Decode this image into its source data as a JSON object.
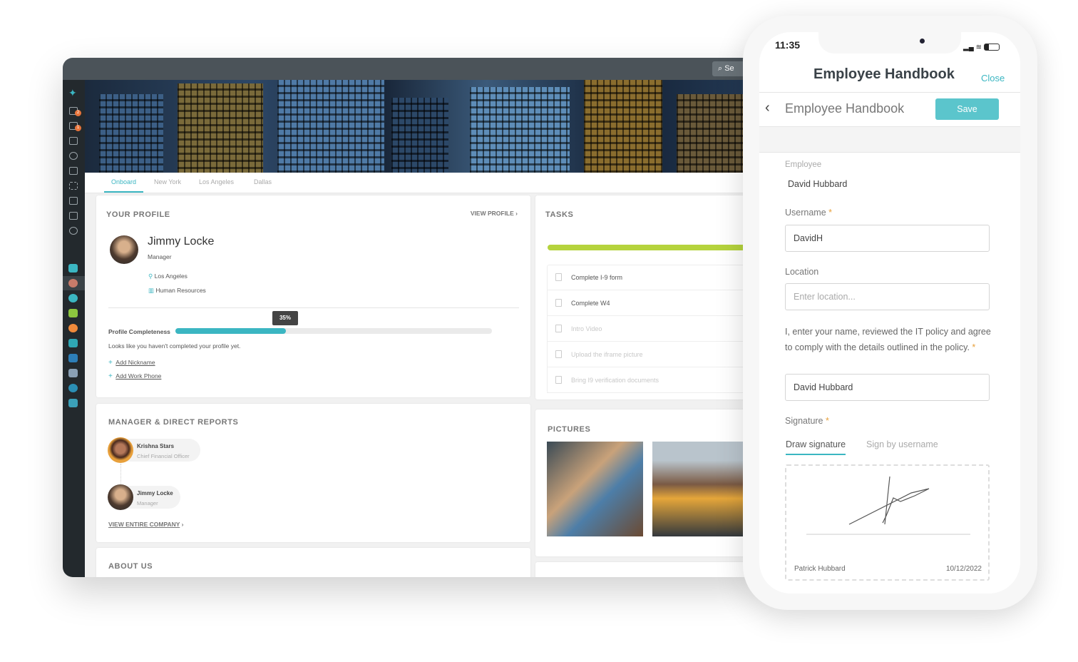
{
  "desktop": {
    "search_label": "Se",
    "sidebar_badges": [
      "2",
      "1"
    ],
    "tabs": [
      {
        "label": "Onboard",
        "active": true
      },
      {
        "label": "New York"
      },
      {
        "label": "Los Angeles"
      },
      {
        "label": "Dallas"
      }
    ],
    "profile": {
      "title": "YOUR PROFILE",
      "view_link": "VIEW PROFILE",
      "name": "Jimmy Locke",
      "role": "Manager",
      "location": "Los Angeles",
      "department": "Human Resources",
      "completeness_label": "Profile Completeness",
      "completeness_percent": 35,
      "completeness_text": "35%",
      "hint": "Looks like you haven't completed your profile yet.",
      "add_nickname": "Add Nickname",
      "add_work_phone": "Add Work Phone"
    },
    "tasks": {
      "title": "TASKS",
      "progress_percent": 100,
      "progress_color": "#b5d33d",
      "items": [
        {
          "label": "Complete I-9 form",
          "icon": "document-icon",
          "done": false
        },
        {
          "label": "Complete W4",
          "icon": "document-icon",
          "done": false
        },
        {
          "label": "Intro Video",
          "icon": "video-icon",
          "done": true
        },
        {
          "label": "Upload the iframe picture",
          "icon": "paperclip-icon",
          "done": true
        },
        {
          "label": "Bring I9 verification documents",
          "icon": "checkbox-icon",
          "done": true
        }
      ]
    },
    "manager": {
      "title": "MANAGER & DIRECT REPORTS",
      "people": [
        {
          "name": "Krishna Stars",
          "role": "Chief Financial Officer"
        },
        {
          "name": "Jimmy Locke",
          "role": "Manager"
        }
      ],
      "view_company": "VIEW ENTIRE COMPANY"
    },
    "pictures": {
      "title": "PICTURES"
    },
    "about": {
      "title": "ABOUT US"
    },
    "accent": "#3bb6c2"
  },
  "phone": {
    "time": "11:35",
    "title": "Employee Handbook",
    "close": "Close",
    "subtitle": "Employee Handbook",
    "save": "Save",
    "employee_label": "Employee",
    "employee_value": "David Hubbard",
    "username_label": "Username",
    "username_value": "DavidH",
    "location_label": "Location",
    "location_placeholder": "Enter location...",
    "policy_label": "I, enter your name, reviewed the IT policy and agree to comply with the details outlined in the policy.",
    "policy_value": "David Hubbard",
    "signature_label": "Signature",
    "sig_tabs": [
      "Draw signature",
      "Sign by username"
    ],
    "sig_name": "Patrick Hubbard",
    "sig_date": "10/12/2022",
    "required_mark": "*"
  }
}
